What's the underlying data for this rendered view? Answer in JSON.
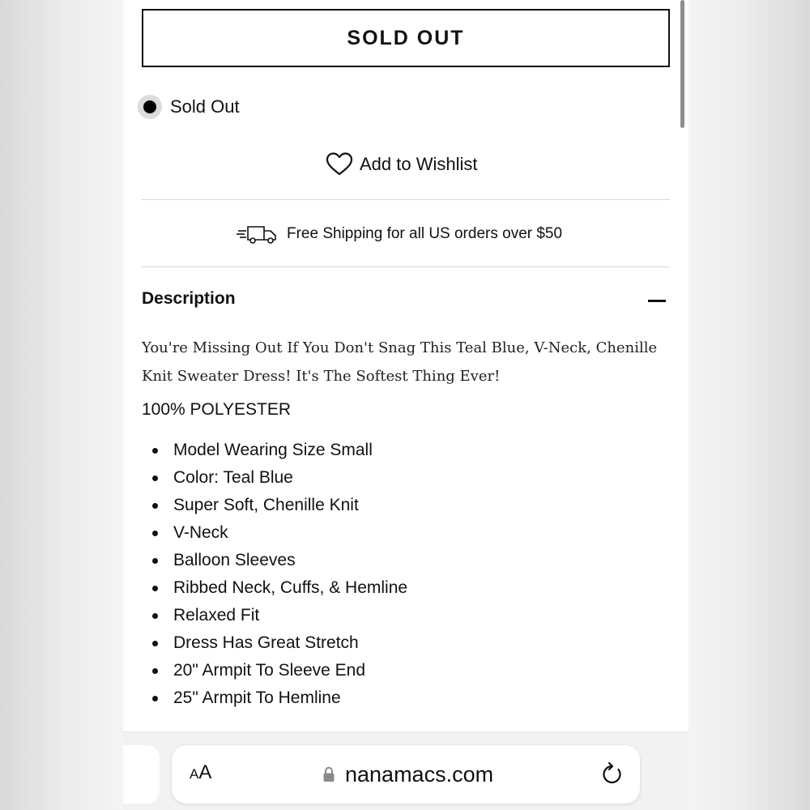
{
  "product": {
    "sold_out_button": "SOLD OUT",
    "variant_option": "Sold Out",
    "wishlist_label": "Add to Wishlist",
    "shipping_note": "Free Shipping for all US orders over $50"
  },
  "description": {
    "title": "Description",
    "text": "You're Missing Out If You Don't Snag This Teal Blue, V-Neck, Chenille Knit Sweater Dress! It's The Softest Thing Ever!",
    "material": "100% POLYESTER",
    "bullets": [
      "Model Wearing Size Small",
      "Color: Teal Blue",
      "Super Soft, Chenille Knit",
      "V-Neck",
      "Balloon Sleeves",
      "Ribbed Neck, Cuffs, & Hemline",
      "Relaxed Fit",
      "Dress Has Great Stretch",
      "20\" Armpit To Sleeve End",
      "25\" Armpit To Hemline"
    ]
  },
  "browser": {
    "aa_small": "A",
    "aa_large": "A",
    "url": "nanamacs.com"
  },
  "icons": {
    "heart": "heart-icon",
    "truck": "delivery-truck-icon",
    "lock": "lock-icon",
    "reload": "reload-icon",
    "collapse": "minus-icon"
  }
}
